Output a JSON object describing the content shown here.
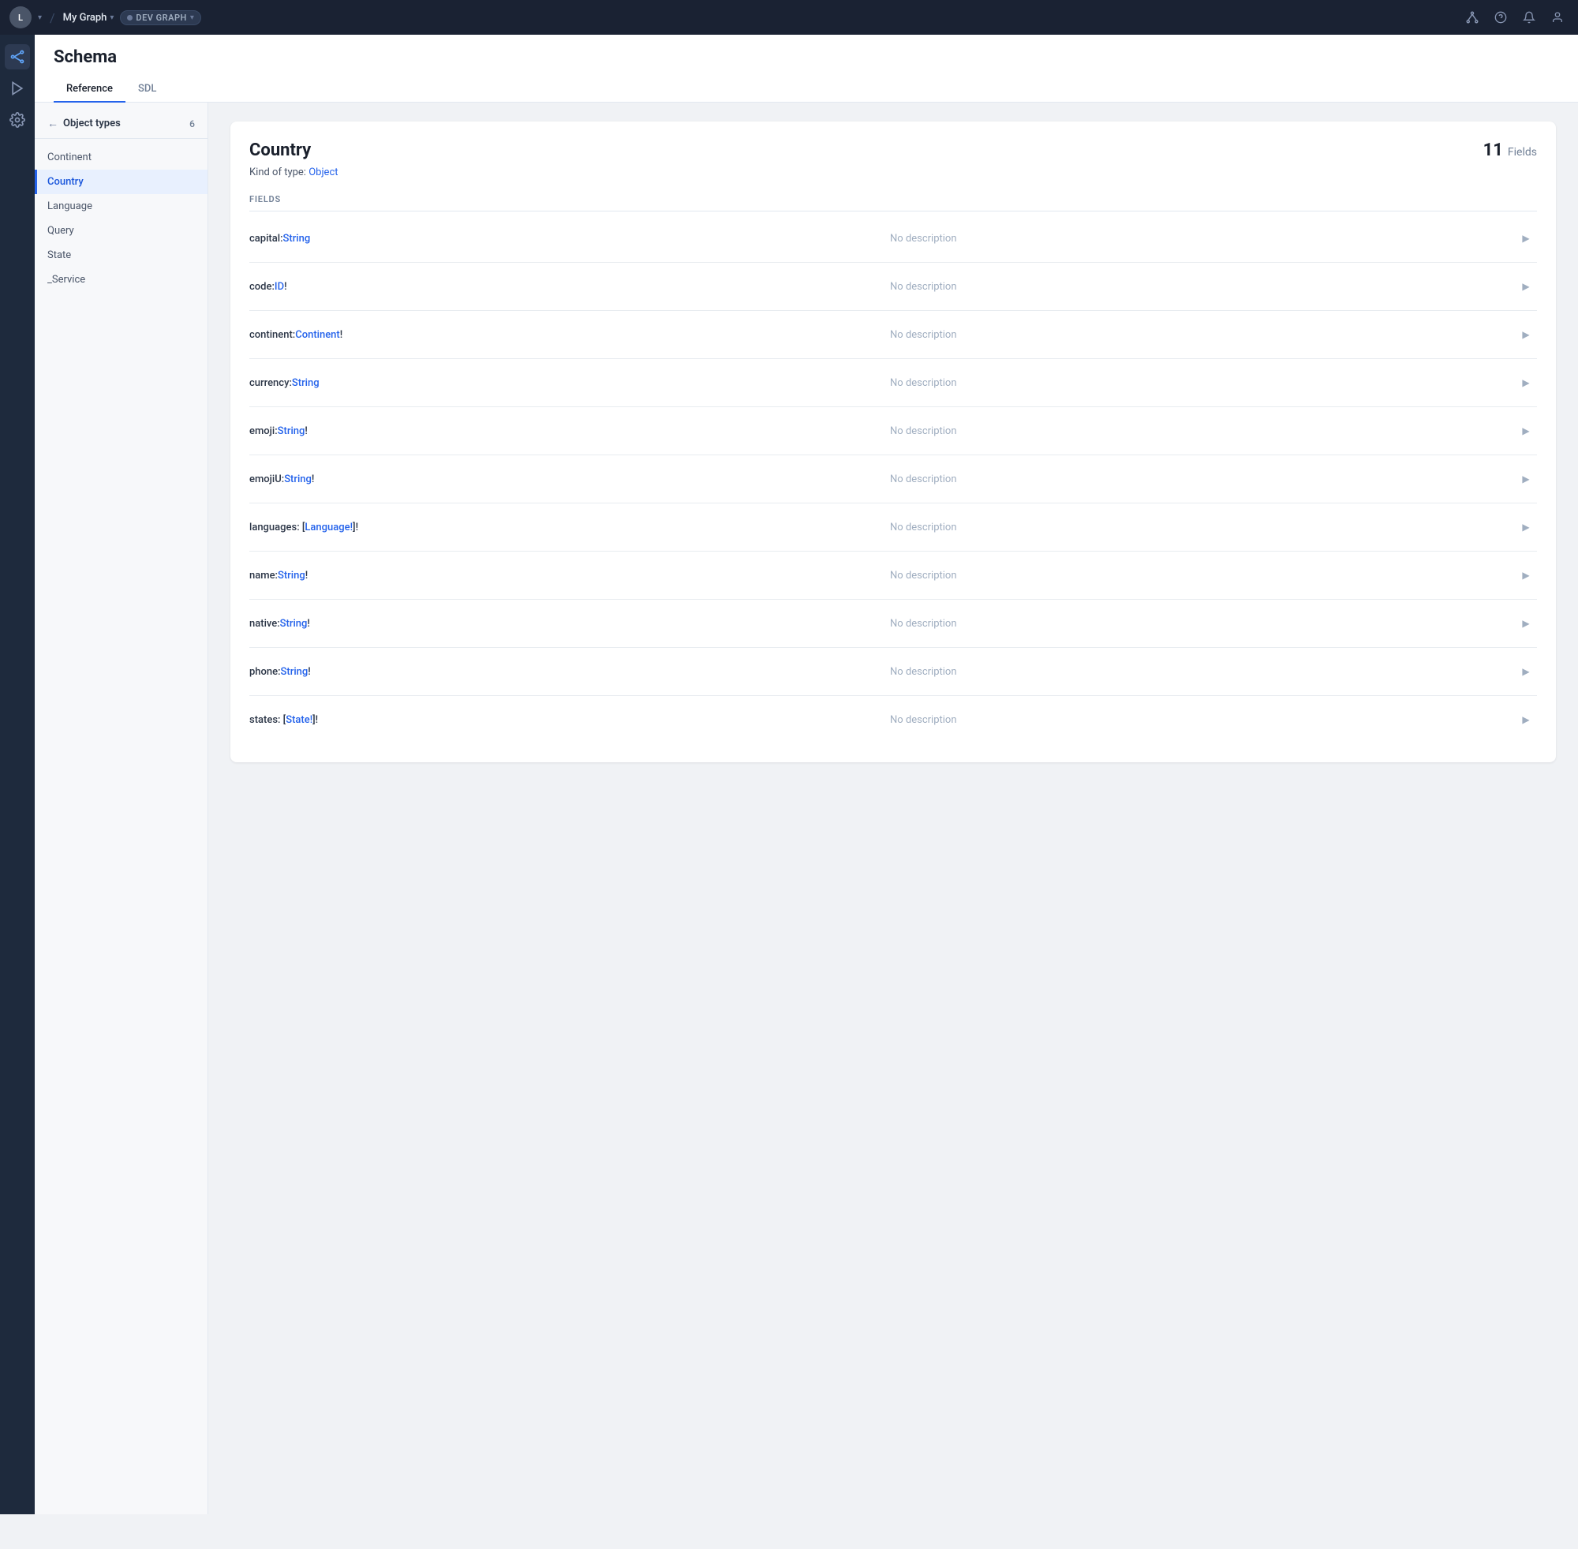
{
  "app": {
    "avatar_initials": "L",
    "graph_name": "My Graph",
    "env_badge": "DEV GRAPH",
    "nav_chevron": "▾"
  },
  "schema": {
    "title": "Schema",
    "tabs": [
      {
        "id": "reference",
        "label": "Reference",
        "active": true
      },
      {
        "id": "sdl",
        "label": "SDL",
        "active": false
      }
    ]
  },
  "sidebar": {
    "back_label": "Object types",
    "object_count": "6",
    "items": [
      {
        "id": "continent",
        "label": "Continent",
        "active": false
      },
      {
        "id": "country",
        "label": "Country",
        "active": true
      },
      {
        "id": "language",
        "label": "Language",
        "active": false
      },
      {
        "id": "query",
        "label": "Query",
        "active": false
      },
      {
        "id": "state",
        "label": "State",
        "active": false
      },
      {
        "id": "_service",
        "label": "_Service",
        "active": false
      }
    ]
  },
  "type_detail": {
    "name": "Country",
    "kind_label": "Kind of type:",
    "kind_value": "Object",
    "field_count": "11",
    "fields_section_label": "FIELDS",
    "fields": [
      {
        "prefix": "capital: ",
        "type": "String",
        "suffix": "",
        "description": "No description"
      },
      {
        "prefix": "code: ",
        "type": "ID",
        "suffix": "!",
        "description": "No description"
      },
      {
        "prefix": "continent: ",
        "type": "Continent",
        "suffix": "!",
        "description": "No description"
      },
      {
        "prefix": "currency: ",
        "type": "String",
        "suffix": "",
        "description": "No description"
      },
      {
        "prefix": "emoji: ",
        "type": "String",
        "suffix": "!",
        "description": "No description"
      },
      {
        "prefix": "emojiU: ",
        "type": "String",
        "suffix": "!",
        "description": "No description"
      },
      {
        "prefix": "languages: [",
        "type": "Language!",
        "suffix": "]!",
        "description": "No description"
      },
      {
        "prefix": "name: ",
        "type": "String",
        "suffix": "!",
        "description": "No description"
      },
      {
        "prefix": "native: ",
        "type": "String",
        "suffix": "!",
        "description": "No description"
      },
      {
        "prefix": "phone: ",
        "type": "String",
        "suffix": "!",
        "description": "No description"
      },
      {
        "prefix": "states: [",
        "type": "State!",
        "suffix": "]!",
        "description": "No description"
      }
    ]
  },
  "icons": {
    "graph_icon": "⬡",
    "play_icon": "▶",
    "settings_icon": "⚙",
    "help_icon": "?",
    "bell_icon": "🔔",
    "user_icon": "👤",
    "back_arrow": "←",
    "arrow_right": "▶"
  }
}
